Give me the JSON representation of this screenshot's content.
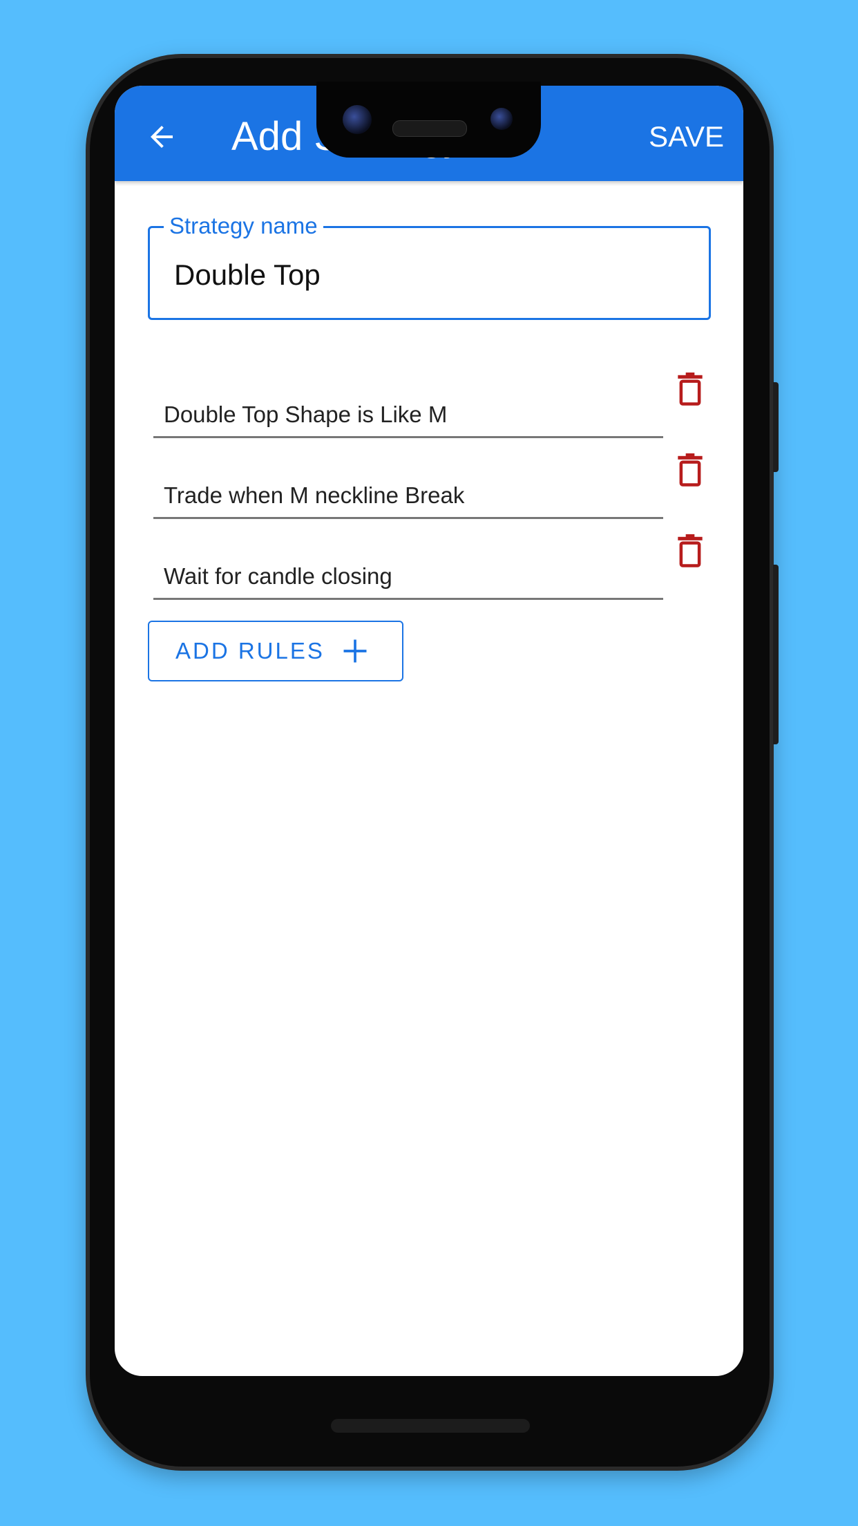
{
  "appbar": {
    "title": "Add Strategy",
    "save_label": "SAVE",
    "back_icon": "arrow-left-icon"
  },
  "form": {
    "strategy_label": "Strategy name",
    "strategy_value": "Double Top",
    "rules": [
      {
        "text": "Double Top Shape is Like M"
      },
      {
        "text": "Trade when M neckline Break"
      },
      {
        "text": "Wait for candle closing"
      }
    ],
    "add_rules_label": "ADD RULES"
  },
  "colors": {
    "primary": "#1b74e4",
    "delete": "#b71c1c",
    "background": "#55bdfd"
  }
}
